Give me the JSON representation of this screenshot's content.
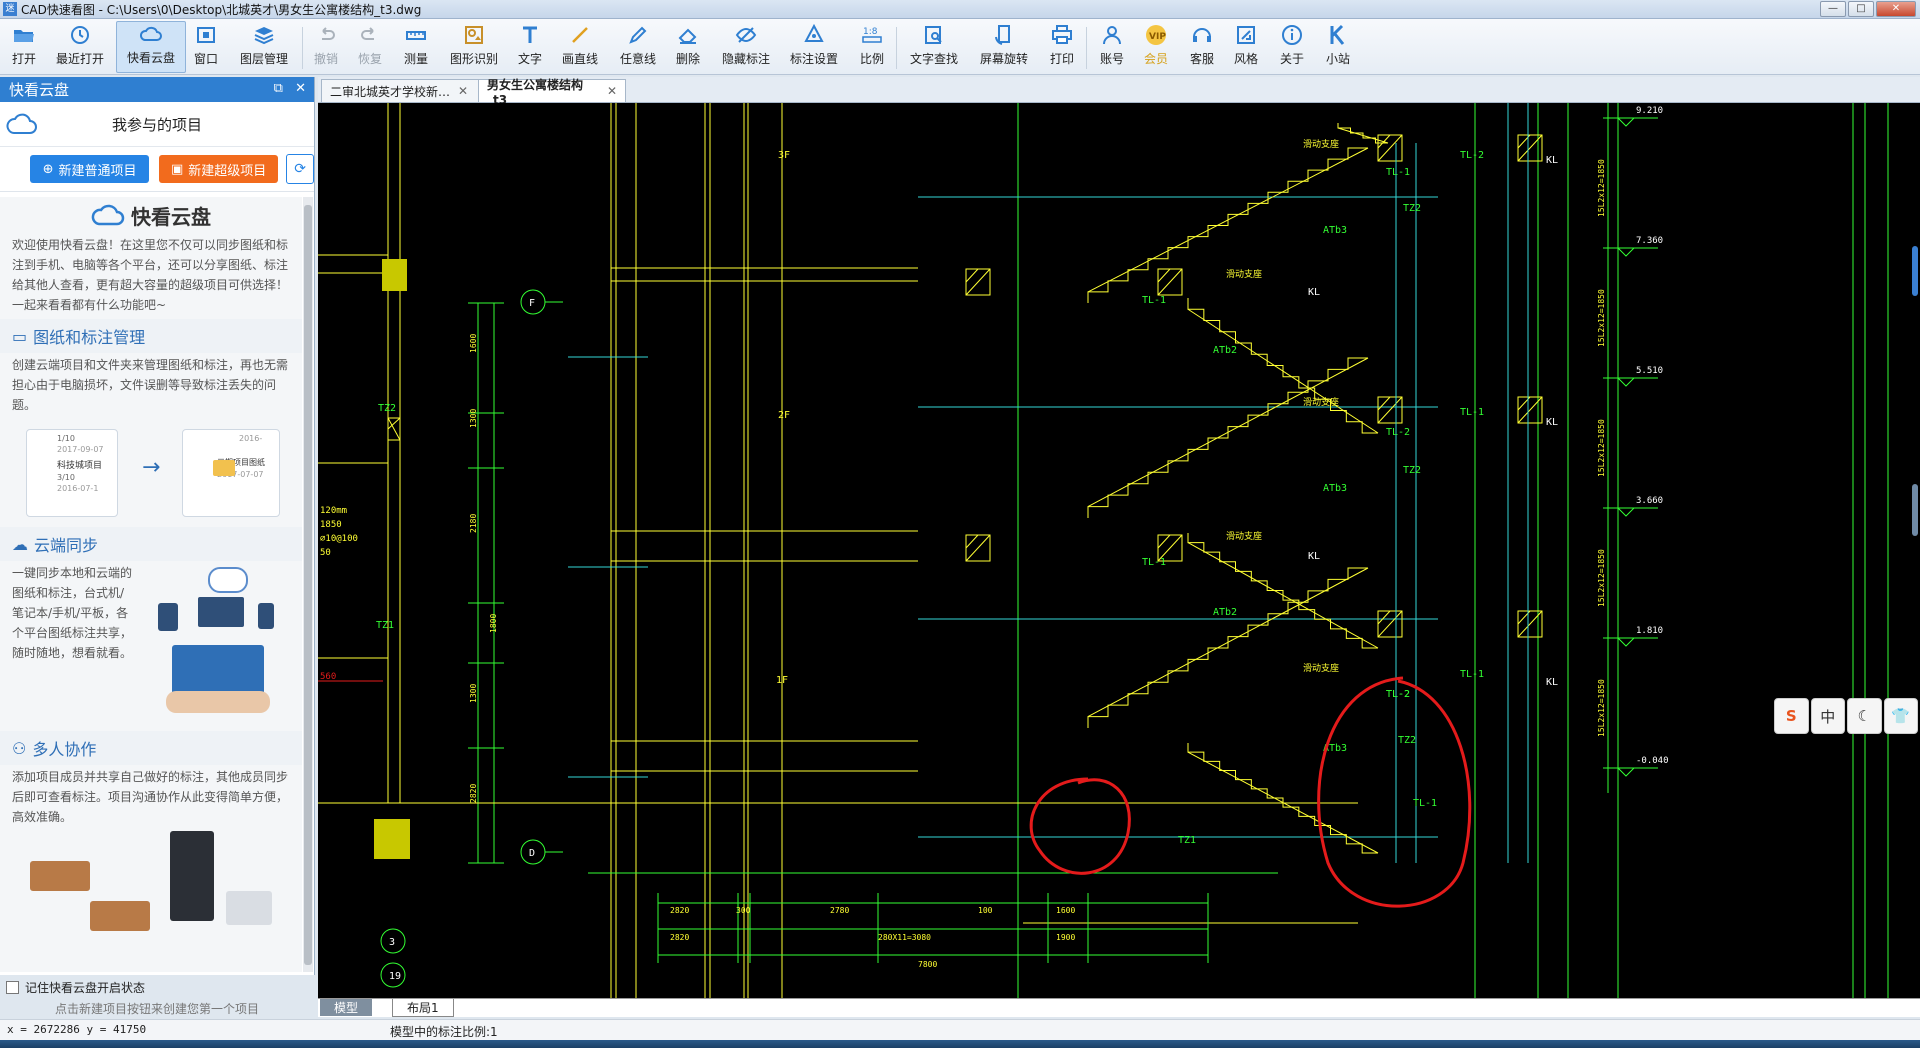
{
  "window": {
    "app_icon": "迷",
    "title": "CAD快速看图 - C:\\Users\\0\\Desktop\\北城英才\\男女生公寓楼结构_t3.dwg",
    "buttons": [
      "minimize-icon",
      "maximize-icon",
      "close-icon"
    ]
  },
  "toolbar": {
    "items": [
      {
        "label": "打开",
        "icon": "open-folder-icon"
      },
      {
        "label": "最近打开",
        "icon": "recent-clock-icon"
      },
      {
        "label": "快看云盘",
        "icon": "cloud-icon",
        "active": true
      },
      {
        "label": "窗口",
        "icon": "window-icon"
      },
      {
        "label": "图层管理",
        "icon": "layers-icon"
      },
      {
        "label": "撤销",
        "icon": "undo-icon",
        "disabled": true
      },
      {
        "label": "恢复",
        "icon": "redo-icon",
        "disabled": true
      },
      {
        "label": "测量",
        "icon": "ruler-icon"
      },
      {
        "label": "图形识别",
        "icon": "shape-recognition-icon"
      },
      {
        "label": "文字",
        "icon": "text-icon"
      },
      {
        "label": "画直线",
        "icon": "line-icon"
      },
      {
        "label": "任意线",
        "icon": "pen-icon"
      },
      {
        "label": "删除",
        "icon": "eraser-icon"
      },
      {
        "label": "隐藏标注",
        "icon": "eye-hide-icon"
      },
      {
        "label": "标注设置",
        "icon": "annotation-settings-icon"
      },
      {
        "label": "比例",
        "icon": "scale-icon"
      },
      {
        "label": "文字查找",
        "icon": "text-search-icon"
      },
      {
        "label": "屏幕旋转",
        "icon": "rotate-screen-icon"
      },
      {
        "label": "打印",
        "icon": "printer-icon"
      },
      {
        "label": "账号",
        "icon": "user-icon"
      },
      {
        "label": "会员",
        "icon": "vip-icon",
        "vip": true
      },
      {
        "label": "客服",
        "icon": "headset-icon"
      },
      {
        "label": "风格",
        "icon": "style-icon"
      },
      {
        "label": "关于",
        "icon": "info-icon"
      },
      {
        "label": "小站",
        "icon": "k-site-icon"
      }
    ]
  },
  "panel": {
    "title": "快看云盘",
    "project_label": "我参与的项目",
    "new_normal": "新建普通项目",
    "new_super": "新建超级项目",
    "brand": "快看云盘",
    "intro_text": "欢迎使用快看云盘！在这里您不仅可以同步图纸和标注到手机、电脑等各个平台，还可以分享图纸、标注给其他人查看，更有超大容量的超级项目可供选择！一起来看看都有什么功能吧~",
    "sections": [
      {
        "title": "图纸和标注管理",
        "text": "创建云端项目和文件夹来管理图纸和标注，再也无需担心由于电脑损坏，文件误删等导致标注丢失的问题。",
        "card_a_items": [
          "1/10",
          "2017-09-07",
          "科技城项目",
          "3/10",
          "2016-07-1"
        ],
        "card_b_items": [
          "2016-",
          "三期项目图纸",
          "2017-07-07"
        ]
      },
      {
        "title": "云端同步",
        "text": "一键同步本地和云端的图纸和标注，台式机/笔记本/手机/平板，各个平台图纸标注共享，随时随地，想看就看。"
      },
      {
        "title": "多人协作",
        "text": "添加项目成员并共享自己做好的标注，其他成员同步后即可查看标注。项目沟通协作从此变得简单方便，高效准确。"
      }
    ],
    "remember_label": "记住快看云盘开启状态",
    "hint": "点击新建项目按钮来创建您第一个项目"
  },
  "tabs": [
    {
      "label": "二审北城英才学校新…",
      "active": false
    },
    {
      "label": "男女生公寓楼结构_t3",
      "active": true
    }
  ],
  "layout_tabs": [
    {
      "label": "模型",
      "active": true
    },
    {
      "label": "布局1",
      "active": false
    }
  ],
  "status": {
    "coords": "x = 2672286  y = 41750",
    "scale_text": "模型中的标注比例:1"
  },
  "ime_toolbar": {
    "items": [
      "sogou-s-icon",
      "中",
      "moon-icon",
      "shirt-icon"
    ]
  },
  "drawing": {
    "colors": {
      "yellow": "#ffff33",
      "cyan": "#33d6d6",
      "green": "#33ff33",
      "white": "#ffffff",
      "red": "#e41b1b",
      "olive": "#c8c800"
    },
    "floor_labels": [
      "3F",
      "2F",
      "1F"
    ],
    "floor_label_color": "#ffff33",
    "elevations": [
      "9.210",
      "7.360",
      "5.510",
      "3.660",
      "1.810",
      "-0.040"
    ],
    "stair_labels": [
      "ATb3",
      "ATb2",
      "ATb3",
      "ATb2",
      "ATb3"
    ],
    "tl_labels": [
      "TL-1",
      "TL-2",
      "TL-1",
      "TL-2",
      "TL-1",
      "TL-1",
      "TL-2",
      "TL-1",
      "TL-1",
      "TL-2"
    ],
    "kl_labels": [
      "KL",
      "KL",
      "KL",
      "KL",
      "KL"
    ],
    "tz_labels": [
      "TZ2",
      "TZ2",
      "TZ2",
      "TZ1",
      "TZ2",
      "TZ1"
    ],
    "slide_support": "滑动支座",
    "axis_bubbles": [
      "F",
      "D",
      "3",
      "19"
    ],
    "left_dims": [
      "1600",
      "1300",
      "2180",
      "1800",
      "1300",
      "2820"
    ],
    "left_notes": [
      "120mm",
      "1850",
      "⌀10@100",
      "50",
      "560"
    ],
    "right_dims": [
      "15L2x12=1850",
      "15L2x12=1850",
      "15L2x12=1850",
      "15L2x12=1850",
      "15L2x12=1850"
    ],
    "bottom_dims_row1": [
      "2820",
      "300",
      "2780",
      "100",
      "1600"
    ],
    "bottom_dims_row2": [
      "2820",
      "280X11=3080",
      "1900"
    ],
    "bottom_total": "7800"
  }
}
